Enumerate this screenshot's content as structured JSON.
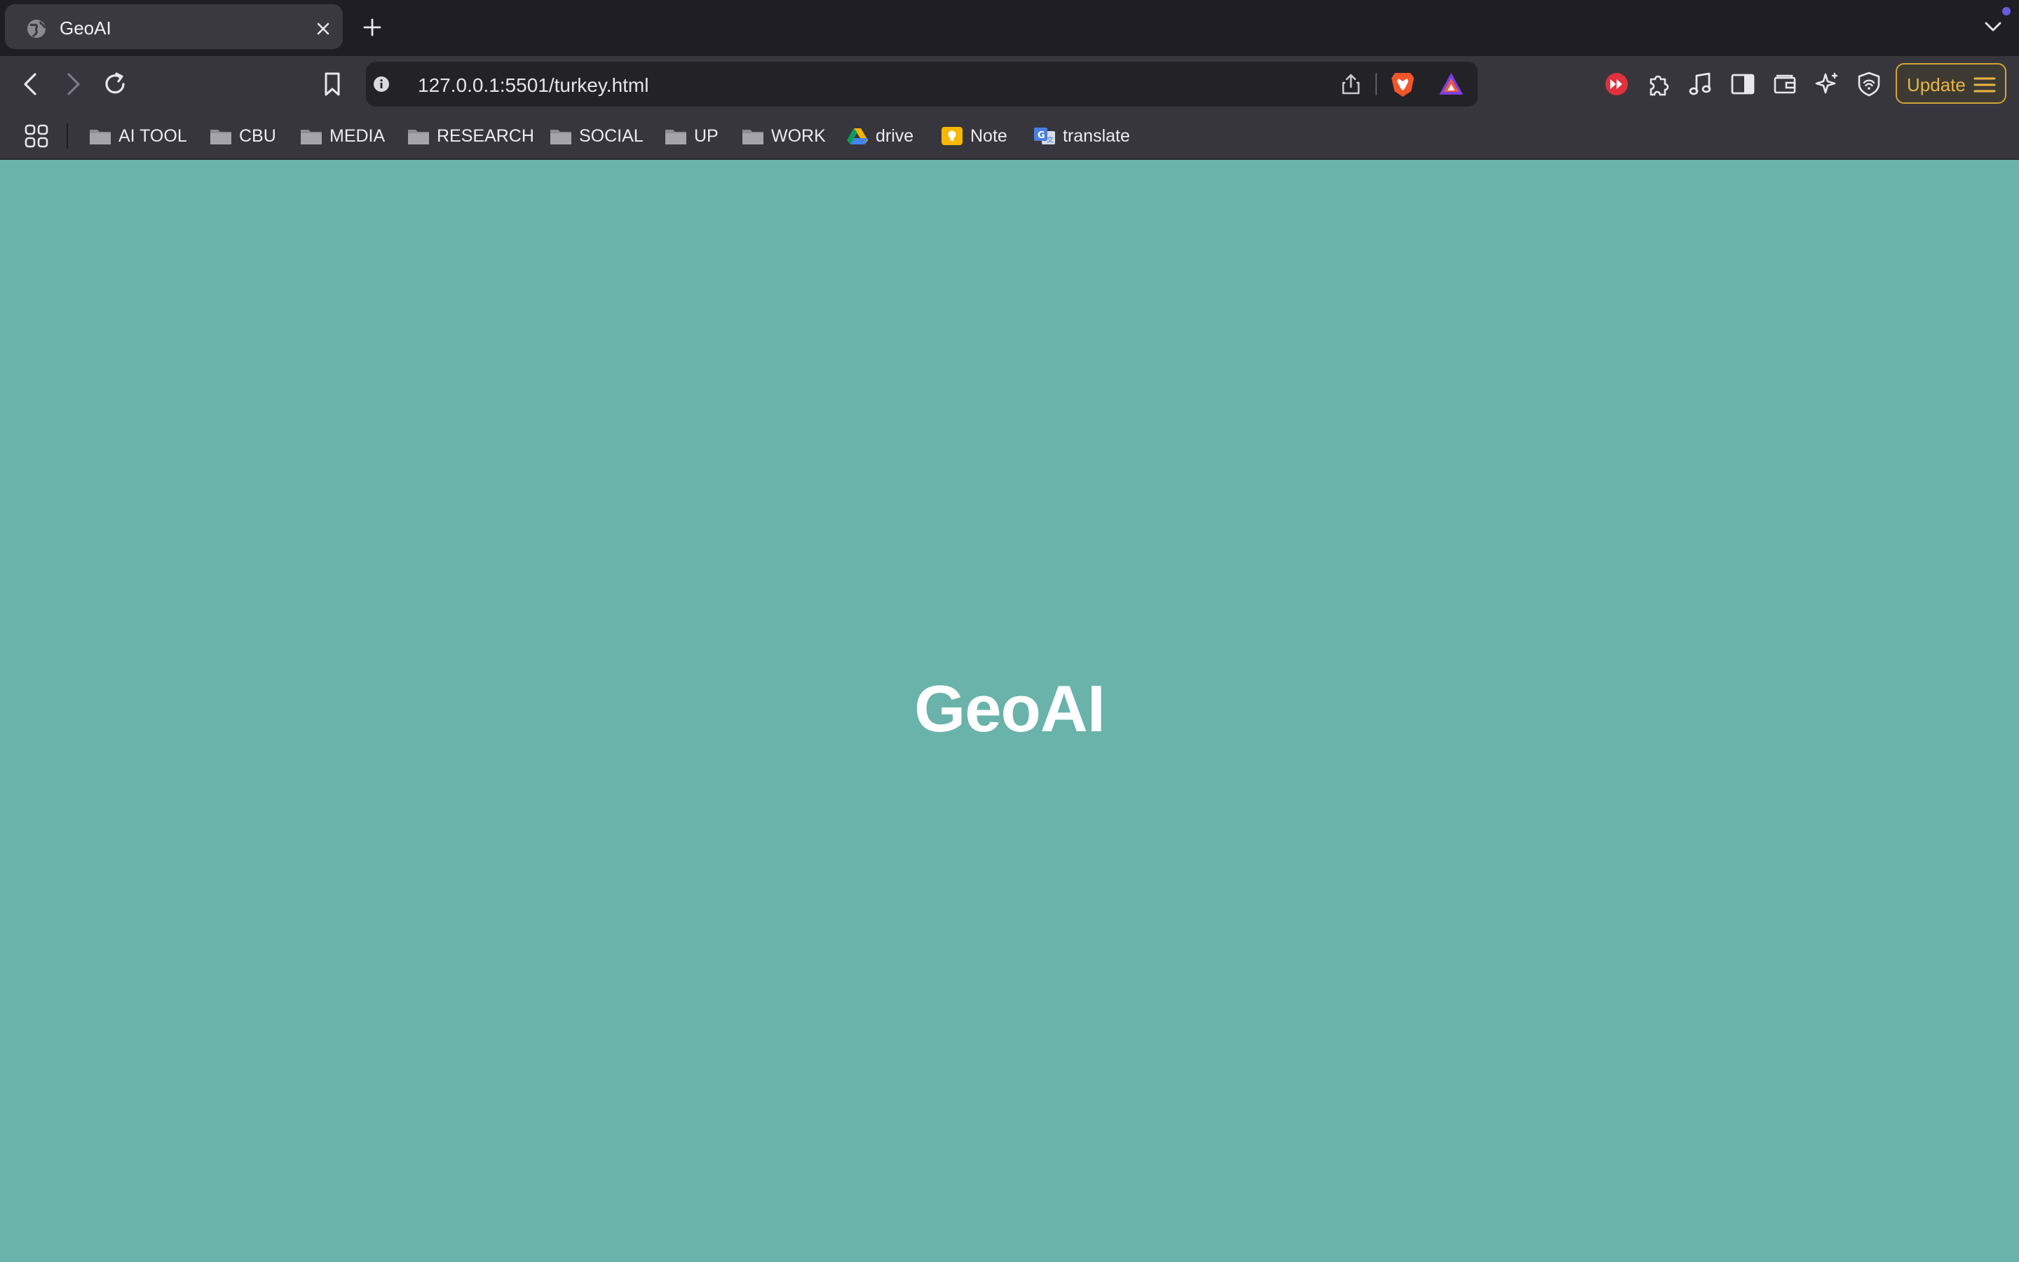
{
  "tab": {
    "title": "GeoAI"
  },
  "address_bar": {
    "url": "127.0.0.1:5501/turkey.html"
  },
  "toolbar": {
    "update_label": "Update"
  },
  "bookmarks": [
    {
      "label": "AI TOOL",
      "icon": "folder-icon"
    },
    {
      "label": "CBU",
      "icon": "folder-icon"
    },
    {
      "label": "MEDIA",
      "icon": "folder-icon"
    },
    {
      "label": "RESEARCH",
      "icon": "folder-icon"
    },
    {
      "label": "SOCIAL",
      "icon": "folder-icon"
    },
    {
      "label": "UP",
      "icon": "folder-icon"
    },
    {
      "label": "WORK",
      "icon": "folder-icon"
    },
    {
      "label": "drive",
      "icon": "google-drive-icon"
    },
    {
      "label": "Note",
      "icon": "keep-note-icon"
    },
    {
      "label": "translate",
      "icon": "google-translate-icon"
    }
  ],
  "page": {
    "heading": "GeoAI",
    "background_color": "#69b3aa"
  },
  "colors": {
    "tab_strip": "#1f1e25",
    "toolbar": "#37363c",
    "update_accent": "#e9b544"
  }
}
